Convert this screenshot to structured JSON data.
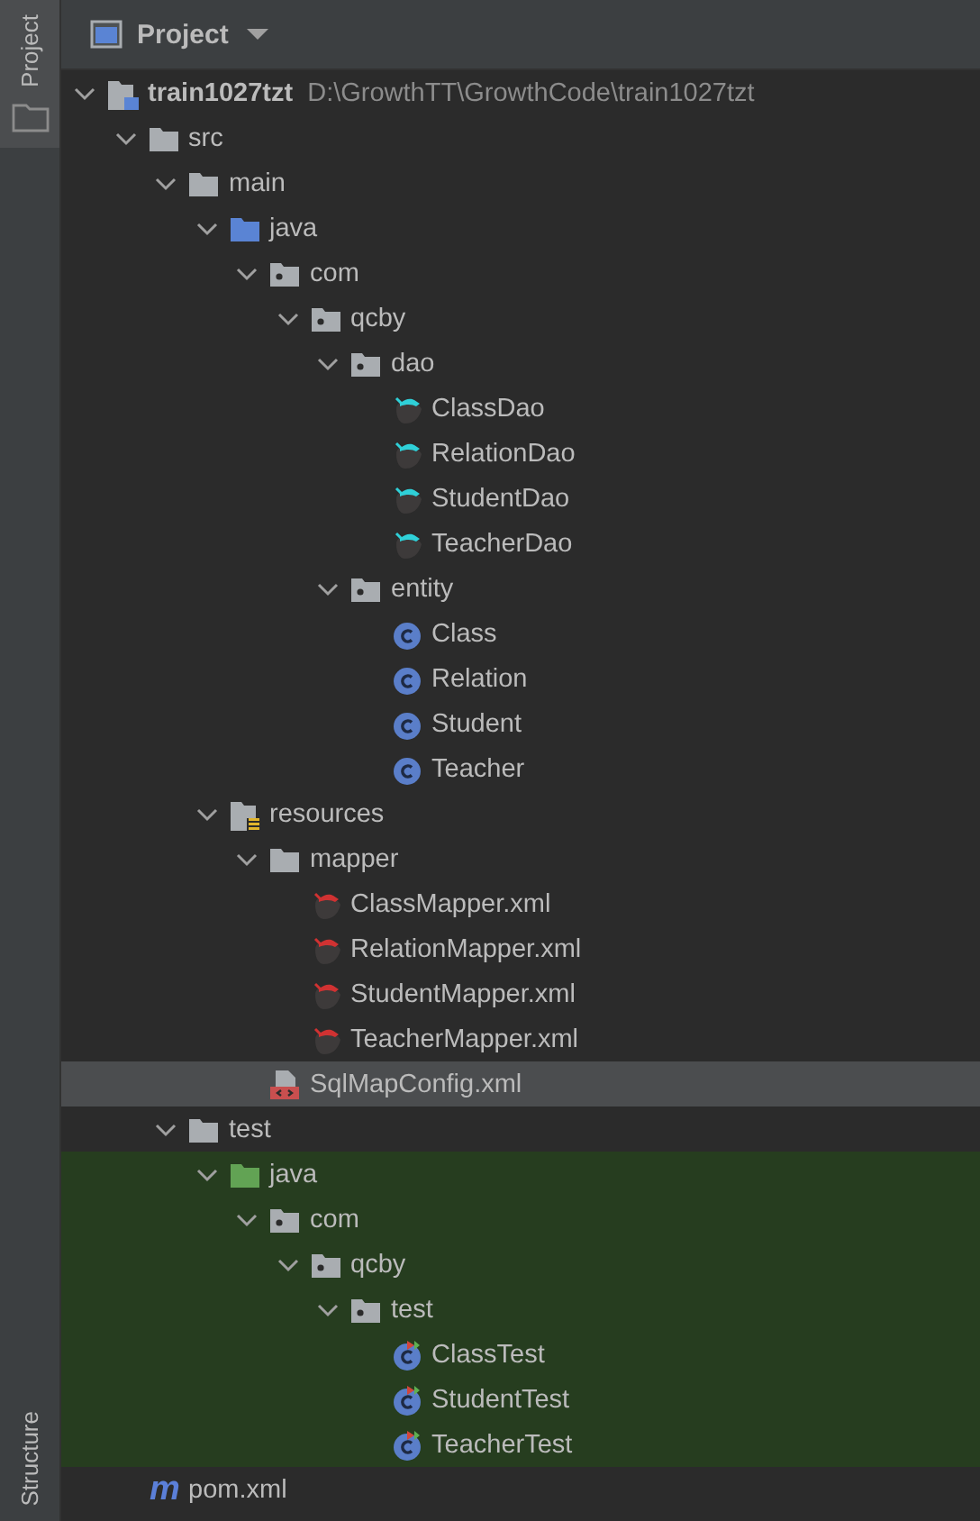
{
  "side_tabs_top": [
    {
      "label": "Project",
      "selected": true
    }
  ],
  "side_tabs_bottom": [
    {
      "label": "Structure",
      "selected": false
    }
  ],
  "panel": {
    "title": "Project"
  },
  "tree": [
    {
      "name": "train1027tzt",
      "path": "D:\\GrowthTT\\GrowthCode\\train1027tzt",
      "kind": "module",
      "expanded": true,
      "selected": false,
      "test_scope": false,
      "children": [
        {
          "name": "src",
          "kind": "folder",
          "expanded": true,
          "selected": false,
          "test_scope": false,
          "children": [
            {
              "name": "main",
              "kind": "folder",
              "expanded": true,
              "selected": false,
              "test_scope": false,
              "children": [
                {
                  "name": "java",
                  "kind": "source-folder",
                  "expanded": true,
                  "selected": false,
                  "test_scope": false,
                  "children": [
                    {
                      "name": "com",
                      "kind": "package",
                      "expanded": true,
                      "selected": false,
                      "test_scope": false,
                      "children": [
                        {
                          "name": "qcby",
                          "kind": "package",
                          "expanded": true,
                          "selected": false,
                          "test_scope": false,
                          "children": [
                            {
                              "name": "dao",
                              "kind": "package",
                              "expanded": true,
                              "selected": false,
                              "test_scope": false,
                              "children": [
                                {
                                  "name": "ClassDao",
                                  "kind": "mapper",
                                  "selected": false,
                                  "test_scope": false
                                },
                                {
                                  "name": "RelationDao",
                                  "kind": "mapper",
                                  "selected": false,
                                  "test_scope": false
                                },
                                {
                                  "name": "StudentDao",
                                  "kind": "mapper",
                                  "selected": false,
                                  "test_scope": false
                                },
                                {
                                  "name": "TeacherDao",
                                  "kind": "mapper",
                                  "selected": false,
                                  "test_scope": false
                                }
                              ]
                            },
                            {
                              "name": "entity",
                              "kind": "package",
                              "expanded": true,
                              "selected": false,
                              "test_scope": false,
                              "children": [
                                {
                                  "name": "Class",
                                  "kind": "class",
                                  "selected": false,
                                  "test_scope": false
                                },
                                {
                                  "name": "Relation",
                                  "kind": "class",
                                  "selected": false,
                                  "test_scope": false
                                },
                                {
                                  "name": "Student",
                                  "kind": "class",
                                  "selected": false,
                                  "test_scope": false
                                },
                                {
                                  "name": "Teacher",
                                  "kind": "class",
                                  "selected": false,
                                  "test_scope": false
                                }
                              ]
                            }
                          ]
                        }
                      ]
                    }
                  ]
                },
                {
                  "name": "resources",
                  "kind": "resources-folder",
                  "expanded": true,
                  "selected": false,
                  "test_scope": false,
                  "children": [
                    {
                      "name": "mapper",
                      "kind": "folder",
                      "expanded": true,
                      "selected": false,
                      "test_scope": false,
                      "children": [
                        {
                          "name": "ClassMapper.xml",
                          "kind": "mapper-xml",
                          "selected": false,
                          "test_scope": false
                        },
                        {
                          "name": "RelationMapper.xml",
                          "kind": "mapper-xml",
                          "selected": false,
                          "test_scope": false
                        },
                        {
                          "name": "StudentMapper.xml",
                          "kind": "mapper-xml",
                          "selected": false,
                          "test_scope": false
                        },
                        {
                          "name": "TeacherMapper.xml",
                          "kind": "mapper-xml",
                          "selected": false,
                          "test_scope": false
                        }
                      ]
                    },
                    {
                      "name": "SqlMapConfig.xml",
                      "kind": "xml",
                      "selected": true,
                      "test_scope": false
                    }
                  ]
                }
              ]
            },
            {
              "name": "test",
              "kind": "folder",
              "expanded": true,
              "selected": false,
              "test_scope": false,
              "children": [
                {
                  "name": "java",
                  "kind": "test-folder",
                  "expanded": true,
                  "selected": false,
                  "test_scope": true,
                  "children": [
                    {
                      "name": "com",
                      "kind": "package",
                      "expanded": true,
                      "selected": false,
                      "test_scope": true,
                      "children": [
                        {
                          "name": "qcby",
                          "kind": "package",
                          "expanded": true,
                          "selected": false,
                          "test_scope": true,
                          "children": [
                            {
                              "name": "test",
                              "kind": "package",
                              "expanded": true,
                              "selected": false,
                              "test_scope": true,
                              "children": [
                                {
                                  "name": "ClassTest",
                                  "kind": "test-class",
                                  "selected": false,
                                  "test_scope": true
                                },
                                {
                                  "name": "StudentTest",
                                  "kind": "test-class",
                                  "selected": false,
                                  "test_scope": true
                                },
                                {
                                  "name": "TeacherTest",
                                  "kind": "test-class",
                                  "selected": false,
                                  "test_scope": true
                                }
                              ]
                            }
                          ]
                        }
                      ]
                    }
                  ]
                }
              ]
            }
          ]
        },
        {
          "name": "pom.xml",
          "kind": "maven",
          "icon_text": "m",
          "selected": false,
          "test_scope": false
        }
      ]
    }
  ]
}
